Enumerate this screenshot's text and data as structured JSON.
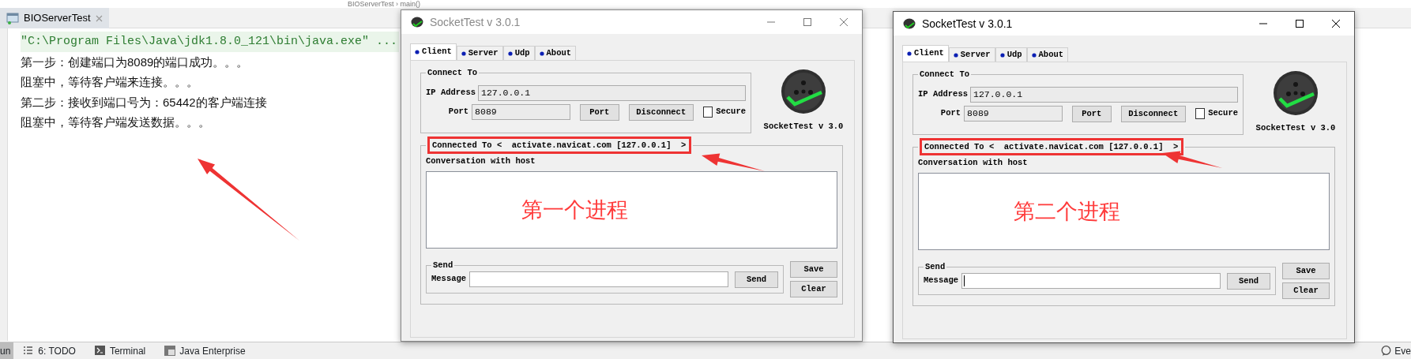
{
  "ide": {
    "breadcrumb": "BIOServerTest › main()",
    "run_tab": {
      "label": "BIOServerTest",
      "selected": true
    },
    "console_lines": [
      {
        "kind": "command",
        "text": "\"C:\\Program Files\\Java\\jdk1.8.0_121\\bin\\java.exe\" ..."
      },
      {
        "kind": "output",
        "text": "第一步：创建端口为8089的端口成功。。。"
      },
      {
        "kind": "output",
        "text": "阻塞中，等待客户端来连接。。。"
      },
      {
        "kind": "output",
        "text": "第二步：接收到端口号为：65442的客户端连接"
      },
      {
        "kind": "output",
        "text": "阻塞中，等待客户端发送数据。。。"
      }
    ],
    "tool_tabs": [
      {
        "kind": "run",
        "label": "un",
        "selected": true
      },
      {
        "kind": "todo",
        "label": "6: TODO",
        "selected": false
      },
      {
        "kind": "terminal",
        "label": "Terminal",
        "selected": false
      },
      {
        "kind": "enterprise",
        "label": "Java Enterprise",
        "selected": false
      }
    ],
    "status_right": "Eve"
  },
  "windows": [
    {
      "title": "SocketTest v 3.0.1",
      "active": false,
      "tabs": [
        {
          "label": "Client",
          "selected": true
        },
        {
          "label": "Server",
          "selected": false
        },
        {
          "label": "Udp",
          "selected": false
        },
        {
          "label": "About",
          "selected": false
        }
      ],
      "connect_legend": "Connect To",
      "ip_label": "IP Address",
      "ip_value": "127.0.0.1",
      "port_label": "Port",
      "port_value": "8089",
      "port_button": "Port",
      "disconnect_button": "Disconnect",
      "secure": {
        "label": "Secure",
        "checked": false
      },
      "logo_caption": "SocketTest v 3.0",
      "connected_legend": "Connected To <  activate.navicat.com [127.0.0.1]  >",
      "conversation_label": "Conversation with host",
      "annotation": "第一个进程",
      "send_legend": "Send",
      "message_label": "Message",
      "message_focused": false,
      "send_button": "Send",
      "save_button": "Save",
      "clear_button": "Clear"
    },
    {
      "title": "SocketTest v 3.0.1",
      "active": true,
      "tabs": [
        {
          "label": "Client",
          "selected": true
        },
        {
          "label": "Server",
          "selected": false
        },
        {
          "label": "Udp",
          "selected": false
        },
        {
          "label": "About",
          "selected": false
        }
      ],
      "connect_legend": "Connect To",
      "ip_label": "IP Address",
      "ip_value": "127.0.0.1",
      "port_label": "Port",
      "port_value": "8089",
      "port_button": "Port",
      "disconnect_button": "Disconnect",
      "secure": {
        "label": "Secure",
        "checked": false
      },
      "logo_caption": "SocketTest v 3.0",
      "connected_legend": "Connected To <  activate.navicat.com [127.0.0.1]  >",
      "conversation_label": "Conversation with host",
      "annotation": "第二个进程",
      "send_legend": "Send",
      "message_label": "Message",
      "message_focused": true,
      "send_button": "Send",
      "save_button": "Save",
      "clear_button": "Clear"
    }
  ]
}
